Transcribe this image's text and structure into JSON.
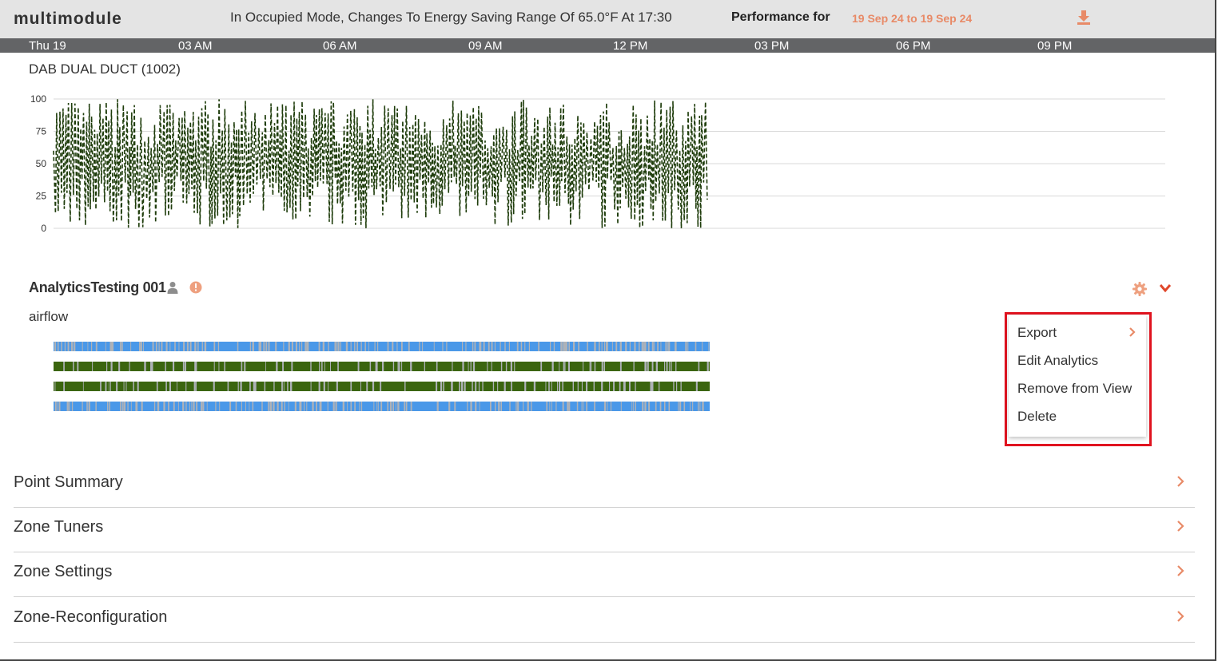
{
  "header": {
    "app_title": "multimodule",
    "mode_message": "In Occupied Mode, Changes To Energy Saving Range Of 65.0°F At 17:30",
    "performance_label": "Performance for",
    "performance_range": "19 Sep 24 to 19 Sep 24",
    "download_icon": "download-icon"
  },
  "timeline": {
    "ticks": [
      "Thu 19",
      "03 AM",
      "06 AM",
      "09 AM",
      "12 PM",
      "03 PM",
      "06 PM",
      "09 PM"
    ]
  },
  "chart_data": {
    "type": "line",
    "title": "DAB DUAL DUCT (1002)",
    "ylim": [
      0,
      100
    ],
    "yticks": [
      "100",
      "75",
      "50",
      "25",
      "0"
    ],
    "series": [
      {
        "color": "#1f3d0c",
        "style": "dashed",
        "description_range": [
          0,
          100
        ]
      }
    ],
    "grid": true
  },
  "analytics": {
    "title": "AnalyticsTesting 001",
    "subtitle": "airflow",
    "user_icon": "user-icon",
    "info_icon": "info-icon",
    "gear_icon": "gear-icon",
    "expand_icon": "chevron-down-icon",
    "timeline_bars": [
      {
        "color": "#4a98e8",
        "alt": "#aeb2b8"
      },
      {
        "color": "#3b650f",
        "alt": "#aeb2b8"
      },
      {
        "color": "#3b650f",
        "alt": "#aeb2b8"
      },
      {
        "color": "#4a98e8",
        "alt": "#aeb2b8"
      }
    ]
  },
  "menu": {
    "items": [
      "Export",
      "Edit Analytics",
      "Remove from View",
      "Delete"
    ]
  },
  "sections": [
    "Point Summary",
    "Zone Tuners",
    "Zone Settings",
    "Zone-Reconfiguration"
  ],
  "colors": {
    "accent": "#e88a67",
    "header_bg": "#e4e4e4",
    "timeline_bg": "#636466",
    "highlight": "#e0131f"
  }
}
